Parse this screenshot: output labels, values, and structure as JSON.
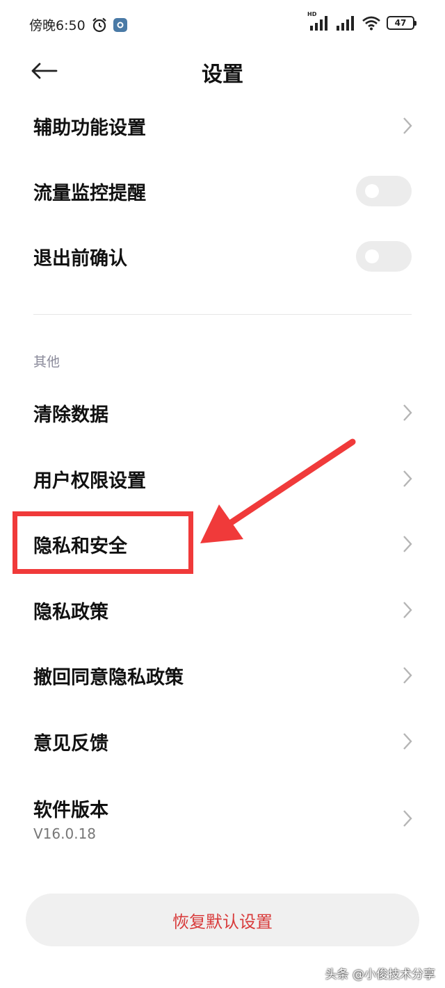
{
  "status_bar": {
    "time": "傍晚6:50",
    "network_label": "HD",
    "battery_level": "47",
    "icons": [
      "alarm-icon",
      "app-notification-icon",
      "signal-icon",
      "signal-icon",
      "wifi-icon",
      "battery-icon"
    ]
  },
  "header": {
    "title": "设置",
    "back_icon": "arrow-left-icon"
  },
  "settings": {
    "accessibility": "辅助功能设置",
    "data_monitor": {
      "label": "流量监控提醒",
      "enabled": false
    },
    "exit_confirm": {
      "label": "退出前确认",
      "enabled": false
    }
  },
  "other_section": {
    "title": "其他",
    "items": {
      "clear_data": "清除数据",
      "user_permissions": "用户权限设置",
      "privacy_security": "隐私和安全",
      "privacy_policy": "隐私政策",
      "revoke_consent": "撤回同意隐私政策",
      "feedback": "意见反馈",
      "version": {
        "label": "软件版本",
        "value": "V16.0.18"
      }
    }
  },
  "restore_button": "恢复默认设置",
  "watermark": "头条 @小俊技术分享",
  "colors": {
    "annotation": "#f03a3a",
    "restore_text": "#d83a3a",
    "section_header": "#8a8a9a",
    "toggle_off": "#ececec"
  }
}
